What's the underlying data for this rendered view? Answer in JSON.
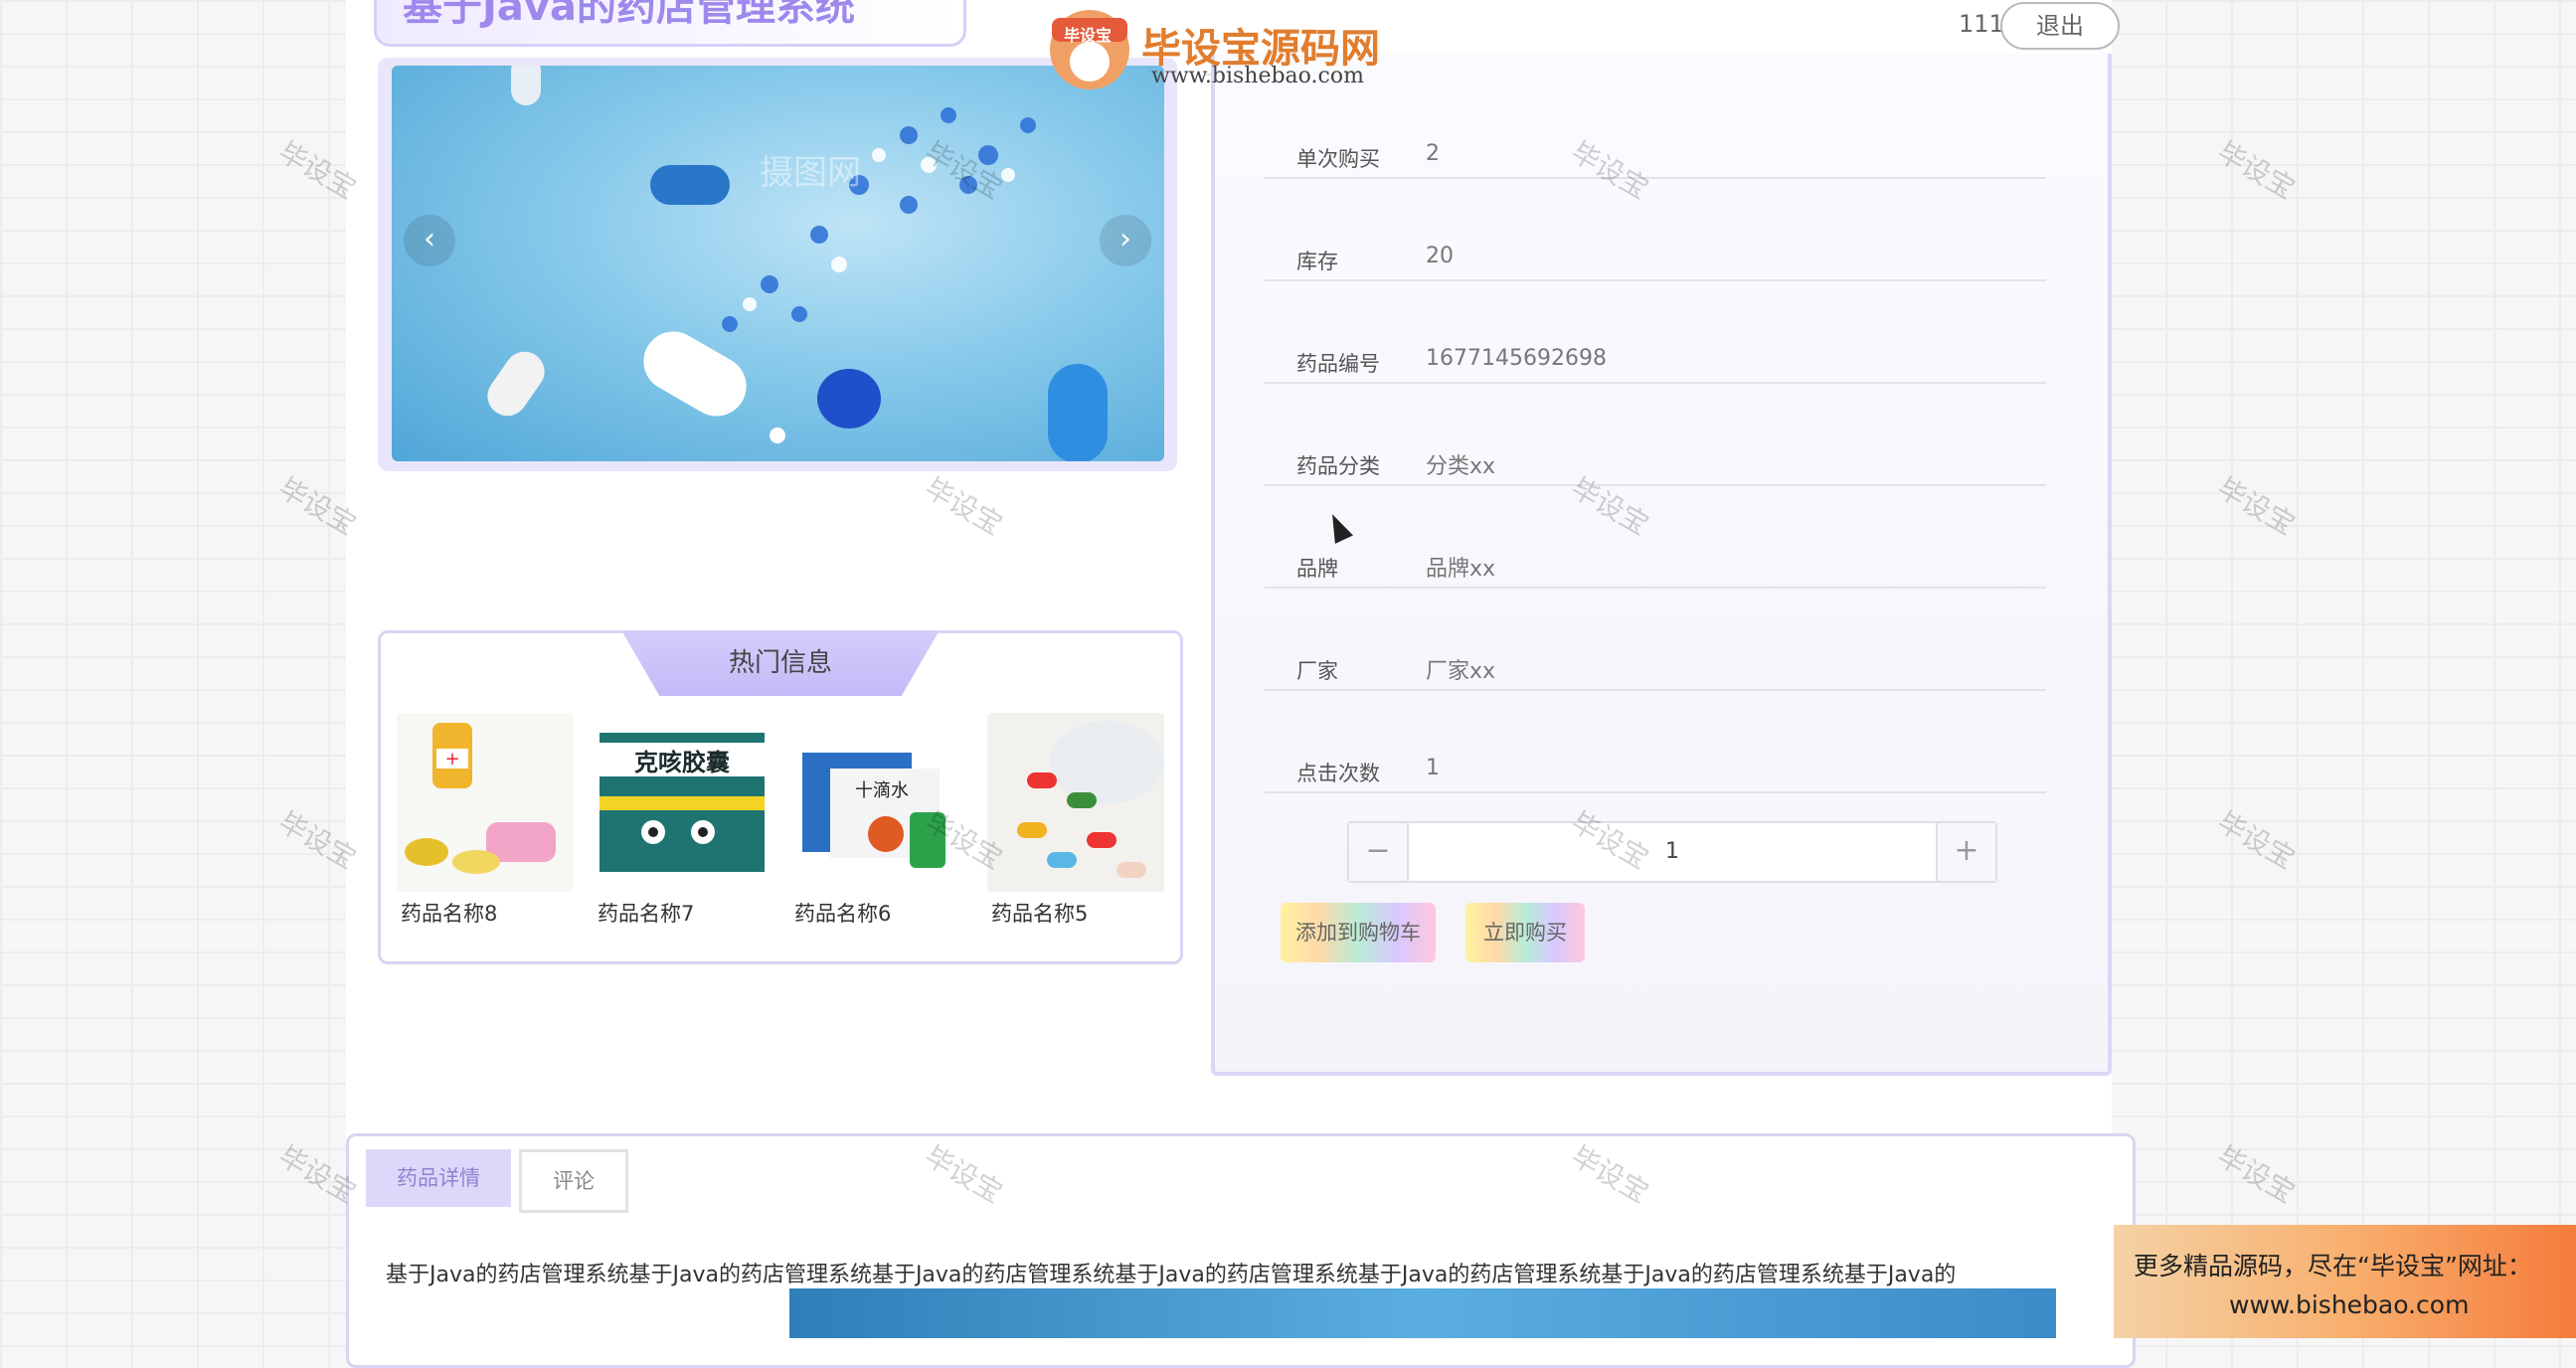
{
  "header": {
    "site_title": "基于Java的药店管理系统",
    "user": "111",
    "logout_label": "退出"
  },
  "banner": {
    "prev_icon": "chevron-left-icon",
    "next_icon": "chevron-right-icon",
    "prev_glyph": "‹",
    "next_glyph": "›",
    "active_slide": 1,
    "image_watermark": "摄图网"
  },
  "hot_info": {
    "title": "热门信息",
    "items": [
      {
        "name": "药品名称8"
      },
      {
        "name": "药品名称7"
      },
      {
        "name": "药品名称6"
      },
      {
        "name": "药品名称5"
      }
    ]
  },
  "detail": {
    "rows": [
      {
        "label": "单次购买",
        "value": "2"
      },
      {
        "label": "库存",
        "value": "20"
      },
      {
        "label": "药品编号",
        "value": "1677145692698"
      },
      {
        "label": "药品分类",
        "value": "分类xx"
      },
      {
        "label": "品牌",
        "value": "品牌xx"
      },
      {
        "label": "厂家",
        "value": "厂家xx"
      },
      {
        "label": "点击次数",
        "value": "1"
      }
    ],
    "quantity": {
      "minus": "−",
      "value": "1",
      "plus": "+"
    },
    "add_to_cart_label": "添加到购物车",
    "buy_now_label": "立即购买"
  },
  "tabs": {
    "detail_label": "药品详情",
    "comment_label": "评论"
  },
  "description": "基于Java的药店管理系统基于Java的药店管理系统基于Java的药店管理系统基于Java的药店管理系统基于Java的药店管理系统基于Java的药店管理系统基于Java的",
  "watermark": {
    "text": "毕设宝",
    "brand_name": "毕设宝源码网",
    "brand_url": "www.bishebao.com",
    "brand_badge": "毕设宝",
    "promo_line1": "更多精品源码，尽在“毕设宝”网址：",
    "promo_line2": "www.bishebao.com"
  },
  "colors": {
    "accent": "#9d88ec",
    "panel_border": "#d9d4f5"
  }
}
